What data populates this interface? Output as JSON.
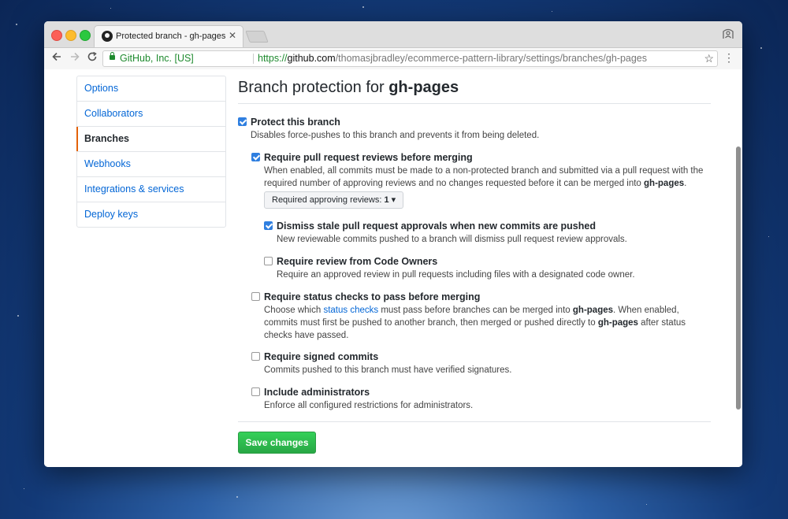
{
  "browser": {
    "tab_title": "Protected branch - gh-pages",
    "tab_close": "✕",
    "secure_label": "GitHub, Inc. [US]",
    "url_scheme": "https://",
    "url_host": "github.com",
    "url_path": "/thomasjbradley/ecommerce-pattern-library/settings/branches/gh-pages"
  },
  "sidebar": {
    "items": [
      {
        "label": "Options"
      },
      {
        "label": "Collaborators"
      },
      {
        "label": "Branches"
      },
      {
        "label": "Webhooks"
      },
      {
        "label": "Integrations & services"
      },
      {
        "label": "Deploy keys"
      }
    ]
  },
  "page": {
    "title_prefix": "Branch protection for",
    "branch": "gh-pages"
  },
  "options": {
    "protect": {
      "label": "Protect this branch",
      "desc": "Disables force-pushes to this branch and prevents it from being deleted.",
      "checked": true
    },
    "reviews": {
      "label": "Require pull request reviews before merging",
      "desc_1": "When enabled, all commits must be made to a non-protected branch and submitted via a pull request with the required number of approving reviews and no changes requested before it can be merged into",
      "branch": "gh-pages",
      "desc_end": ".",
      "dropdown_label": "Required approving reviews:",
      "dropdown_value": "1",
      "checked": true
    },
    "dismiss": {
      "label": "Dismiss stale pull request approvals when new commits are pushed",
      "desc": "New reviewable commits pushed to a branch will dismiss pull request review approvals.",
      "checked": true
    },
    "code_owners": {
      "label": "Require review from Code Owners",
      "desc": "Require an approved review in pull requests including files with a designated code owner.",
      "checked": false
    },
    "status": {
      "label": "Require status checks to pass before merging",
      "desc_pre": "Choose which",
      "link": "status checks",
      "desc_mid": "must pass before branches can be merged into",
      "branch_1": "gh-pages",
      "desc_mid2": ". When enabled, commits must first be pushed to another branch, then merged or pushed directly to",
      "branch_2": "gh-pages",
      "desc_end": "after status checks have passed.",
      "checked": false
    },
    "signed": {
      "label": "Require signed commits",
      "desc": "Commits pushed to this branch must have verified signatures.",
      "checked": false
    },
    "admins": {
      "label": "Include administrators",
      "desc": "Enforce all configured restrictions for administrators.",
      "checked": false
    }
  },
  "actions": {
    "save_label": "Save changes"
  },
  "colors": {
    "accent": "#e36209",
    "link": "#0366d6",
    "save_green": "#28a745",
    "checkbox": "#2f7fe0"
  }
}
